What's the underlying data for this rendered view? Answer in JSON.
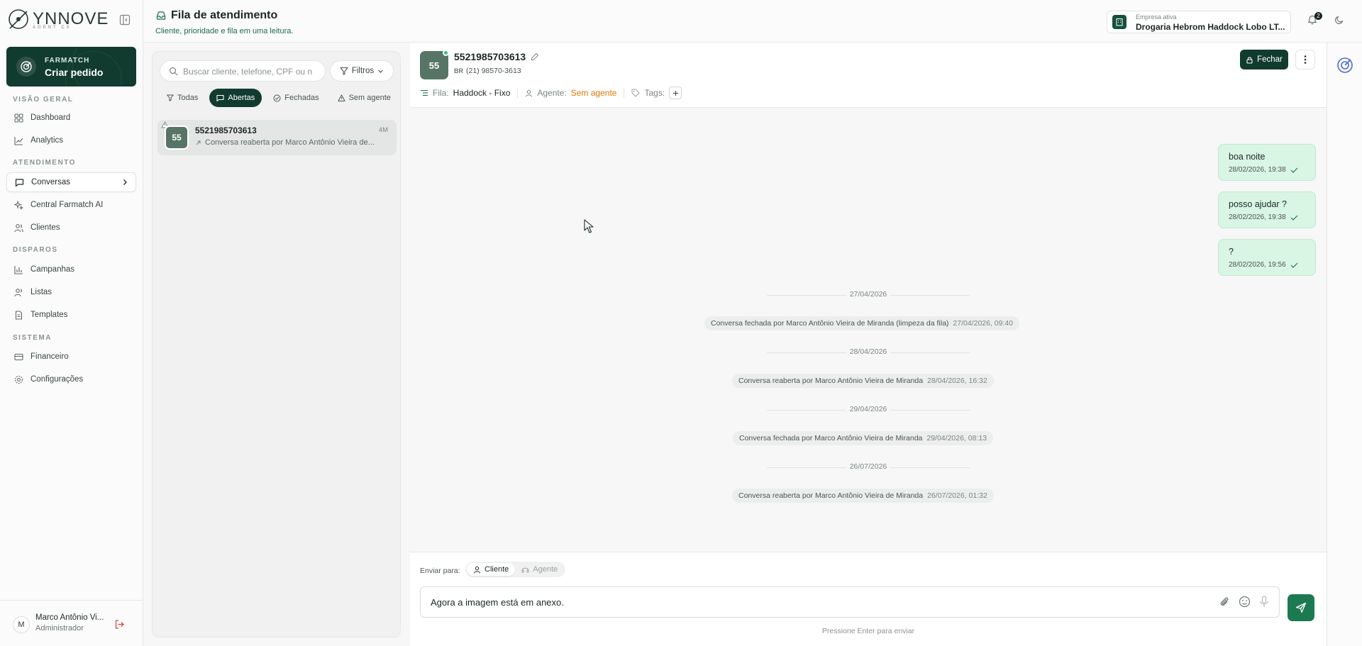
{
  "sidebar": {
    "brand": {
      "name": "YNNOVE",
      "tagline": "AGENT CX"
    },
    "cta": {
      "kicker": "FARMATCH",
      "title": "Criar pedido"
    },
    "sections": {
      "overview": "VISÃO GERAL",
      "service": "ATENDIMENTO",
      "dispatch": "DISPAROS",
      "system": "SISTEMA"
    },
    "items": {
      "dashboard": "Dashboard",
      "analytics": "Analytics",
      "conversas": "Conversas",
      "central": "Central Farmatch AI",
      "clientes": "Clientes",
      "campanhas": "Campanhas",
      "listas": "Listas",
      "templates": "Templates",
      "financeiro": "Financeiro",
      "configuracoes": "Configurações"
    },
    "user": {
      "initial": "M",
      "name": "Marco Antônio Vi...",
      "role": "Administrador"
    }
  },
  "header": {
    "title": "Fila de atendimento",
    "subtitle": "Cliente, prioridade e fila em uma leitura.",
    "company_label": "Empresa ativa",
    "company_value": "Drogaria Hebrom Haddock Lobo LT...",
    "notifications": "2"
  },
  "list": {
    "search_placeholder": "Buscar cliente, telefone, CPF ou n",
    "filters_label": "Filtros",
    "tabs": [
      "Todas",
      "Abertas",
      "Fechadas",
      "Sem agente"
    ],
    "active_tab": "Abertas",
    "conversations": [
      {
        "avatar": "55",
        "title": "5521985703613",
        "time": "4M",
        "preview": "Conversa reaberta por Marco Antônio Vieira de..."
      }
    ]
  },
  "chat": {
    "avatar": "55",
    "name": "5521985703613",
    "country": "BR",
    "phone": "(21) 98570-3613",
    "queue_label": "Fila:",
    "queue_value": "Haddock - Fixo",
    "agent_label": "Agente:",
    "agent_value": "Sem agente",
    "tags_label": "Tags:",
    "close_label": "Fechar",
    "messages": [
      {
        "text": "boa noite",
        "time": "28/02/2026, 19:38"
      },
      {
        "text": "posso ajudar ?",
        "time": "28/02/2026, 19:38"
      },
      {
        "text": "?",
        "time": "28/02/2026, 19:56"
      }
    ],
    "timeline": [
      {
        "date": "27/04/2026",
        "event": "Conversa fechada por Marco Antônio Vieira de Miranda (limpeza da fila)",
        "time": "27/04/2026, 09:40"
      },
      {
        "date": "28/04/2026",
        "event": "Conversa reaberta por Marco Antônio Vieira de Miranda",
        "time": "28/04/2026, 16:32"
      },
      {
        "date": "29/04/2026",
        "event": "Conversa fechada por Marco Antônio Vieira de Miranda",
        "time": "29/04/2026, 08:13"
      },
      {
        "date": "26/07/2026",
        "event": "Conversa reaberta por Marco Antônio Vieira de Miranda",
        "time": "26/07/2026, 01:32"
      }
    ]
  },
  "composer": {
    "send_to_label": "Enviar para:",
    "target_client": "Cliente",
    "target_agent": "Agente",
    "input_value": "Agora a imagem está em anexo.",
    "hint": "Pressione Enter para enviar"
  },
  "colors": {
    "brand_dark": "#123b2f",
    "accent_green": "#1c7a52",
    "bubble_bg": "#d9f5e4",
    "agent_warning": "#d97706",
    "online": "#3cc07a"
  },
  "icons": [
    "filter-icon",
    "search-icon",
    "bell-icon",
    "moon-icon",
    "building-icon",
    "lock-icon",
    "more-vertical-icon",
    "paperclip-icon",
    "smile-icon",
    "mic-icon",
    "send-icon",
    "check-icon",
    "tag-icon",
    "user-icon",
    "headset-icon",
    "logout-icon",
    "inbox-icon"
  ]
}
